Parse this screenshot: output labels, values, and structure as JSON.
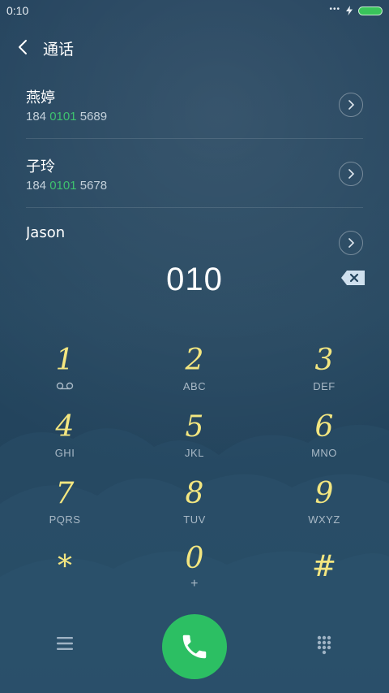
{
  "status_bar": {
    "time": "0:10",
    "more": "•••"
  },
  "header": {
    "title": "通话"
  },
  "contacts": [
    {
      "name": "燕婷",
      "phone_prefix": "184 ",
      "phone_match": "0101",
      "phone_suffix": " 5689"
    },
    {
      "name": "子玲",
      "phone_prefix": "184 ",
      "phone_match": "0101",
      "phone_suffix": " 5678"
    },
    {
      "name": "Jason"
    }
  ],
  "dialer": {
    "number": "010"
  },
  "keypad": [
    {
      "digit": "1",
      "letters": "",
      "icon": "voicemail-icon"
    },
    {
      "digit": "2",
      "letters": "ABC"
    },
    {
      "digit": "3",
      "letters": "DEF"
    },
    {
      "digit": "4",
      "letters": "GHI"
    },
    {
      "digit": "5",
      "letters": "JKL"
    },
    {
      "digit": "6",
      "letters": "MNO"
    },
    {
      "digit": "7",
      "letters": "PQRS"
    },
    {
      "digit": "8",
      "letters": "TUV"
    },
    {
      "digit": "9",
      "letters": "WXYZ"
    },
    {
      "digit": "*",
      "letters": ""
    },
    {
      "digit": "0",
      "letters": "+"
    },
    {
      "digit": "#",
      "letters": ""
    }
  ],
  "colors": {
    "accent_match": "#3ec26f",
    "call_button": "#2cbf63",
    "digit": "#f3e680",
    "battery": "#39c45b",
    "background": "#22435c"
  },
  "icons": {
    "back": "chevron-left-icon",
    "detail": "chevron-right-icon",
    "backspace": "backspace-icon",
    "menu": "hamburger-menu-icon",
    "call": "phone-icon",
    "keypad_toggle": "dialpad-icon"
  }
}
